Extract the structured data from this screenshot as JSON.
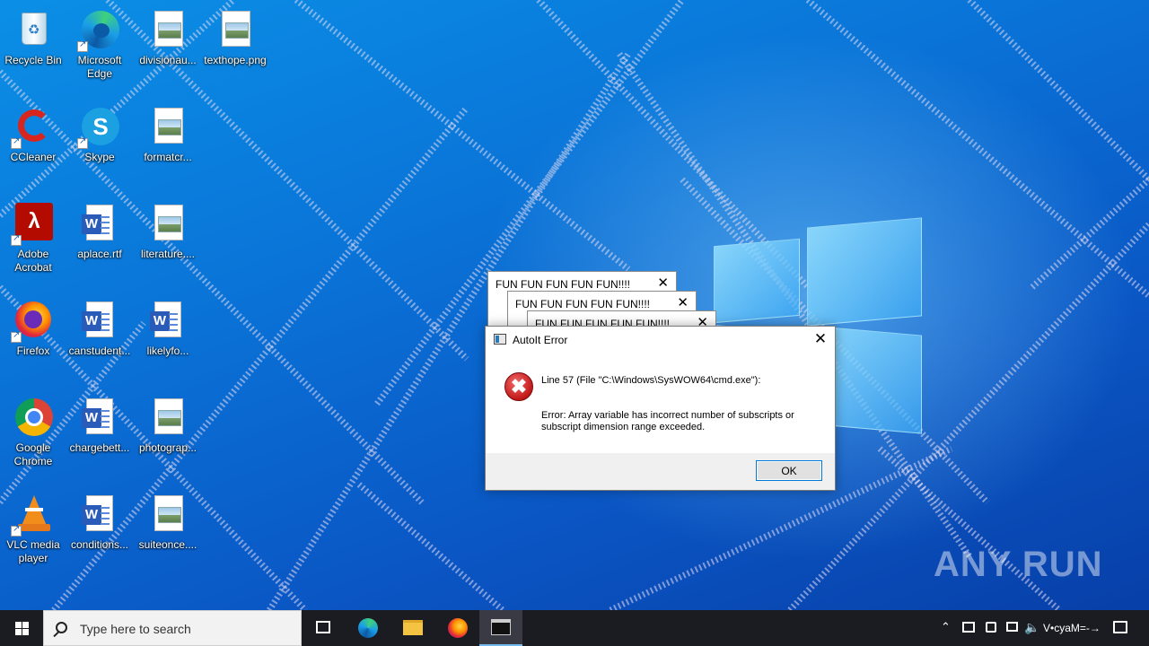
{
  "desktop": {
    "icons": [
      {
        "label": "Recycle Bin"
      },
      {
        "label": "Microsoft Edge"
      },
      {
        "label": "divisionau..."
      },
      {
        "label": "texthope.png"
      },
      {
        "label": "CCleaner"
      },
      {
        "label": "Skype"
      },
      {
        "label": "formatcr..."
      },
      {
        "label": "Adobe Acrobat"
      },
      {
        "label": "aplace.rtf"
      },
      {
        "label": "literature...."
      },
      {
        "label": "Firefox"
      },
      {
        "label": "canstudent..."
      },
      {
        "label": "likelyfo..."
      },
      {
        "label": "Google Chrome"
      },
      {
        "label": "chargebett..."
      },
      {
        "label": "photograp..."
      },
      {
        "label": "VLC media player"
      },
      {
        "label": "conditions..."
      },
      {
        "label": "suiteonce...."
      }
    ]
  },
  "background_windows": [
    {
      "title": "FUN FUN FUN FUN FUN!!!!"
    },
    {
      "title": "FUN FUN FUN FUN FUN!!!!"
    },
    {
      "title": "FUN FUN FUN FUN FUN!!!!"
    }
  ],
  "dialog": {
    "title": "AutoIt Error",
    "line": "Line 57  (File \"C:\\Windows\\SysWOW64\\cmd.exe\"):",
    "message": "Error: Array variable has incorrect number of subscripts or subscript dimension range exceeded.",
    "ok_label": "OK"
  },
  "watermark": "ANY RUN",
  "taskbar": {
    "search_placeholder": "Type here to search",
    "clock": "V•суaM=-→"
  },
  "colors": {
    "desktop_blue": "#0a75d8",
    "taskbar": "#1b1b22",
    "error_red": "#c21818",
    "button_focus": "#0078d7"
  }
}
